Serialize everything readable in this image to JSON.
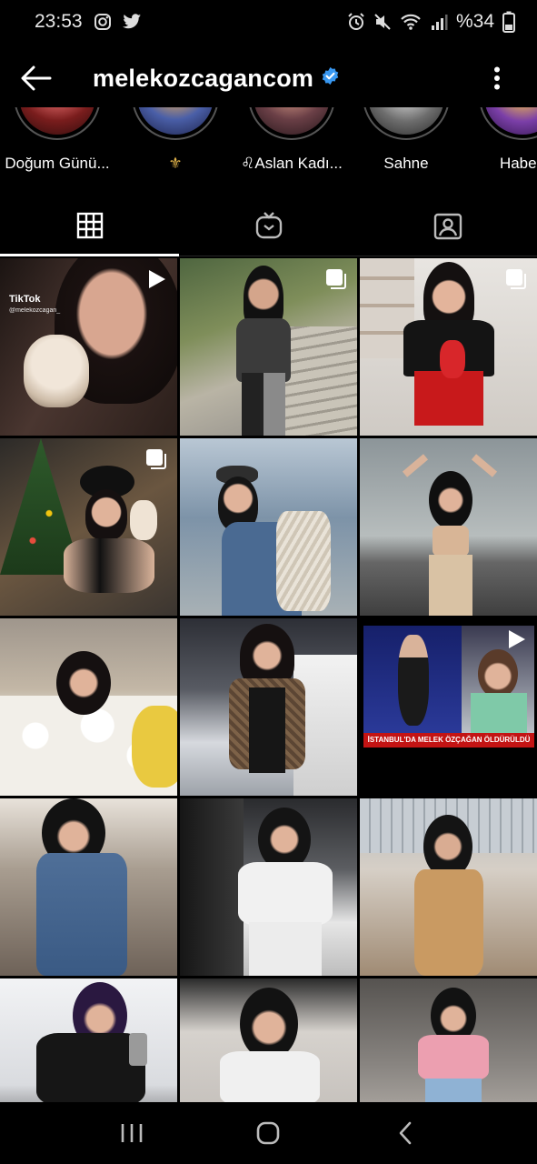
{
  "status_bar": {
    "time": "23:53",
    "battery": "%34"
  },
  "header": {
    "username": "melekozcagancom",
    "verified": true
  },
  "highlights": [
    {
      "label": "Doğum Günü...",
      "color": "#b33a3a"
    },
    {
      "label": "⚜",
      "color": "#4a5fa8"
    },
    {
      "label": "♌Aslan Kadı...",
      "color": "#6a3f46"
    },
    {
      "label": "Sahne",
      "color": "#6d6d6d"
    },
    {
      "label": "Haberl",
      "color": "#7b3fa8"
    }
  ],
  "tabs": [
    {
      "name": "grid",
      "icon": "grid-icon",
      "active": true
    },
    {
      "name": "igtv",
      "icon": "igtv-icon",
      "active": false
    },
    {
      "name": "tagged",
      "icon": "tagged-icon",
      "active": false
    }
  ],
  "posts": [
    {
      "type": "video",
      "tiktok_label": "TikTok",
      "tiktok_handle": "@melekozcagan_",
      "bg": "#3a2a26"
    },
    {
      "type": "carousel",
      "bg": "#6f7a55"
    },
    {
      "type": "carousel",
      "bg": "#d8d4d0"
    },
    {
      "type": "carousel",
      "bg": "#5a4636"
    },
    {
      "type": "photo",
      "bg": "#8fa3b8"
    },
    {
      "type": "photo",
      "bg": "#9aa4a8"
    },
    {
      "type": "photo",
      "bg": "#c8b9a6"
    },
    {
      "type": "photo",
      "bg": "#3b3d42"
    },
    {
      "type": "video",
      "news_caption": "İSTANBUL'DA MELEK ÖZÇAĞAN ÖLDÜRÜLDÜ",
      "bg": "#1f2a7a"
    },
    {
      "type": "photo",
      "bg": "#9a8d80"
    },
    {
      "type": "photo",
      "bg": "#6c6a66"
    },
    {
      "type": "photo",
      "bg": "#c9b9a4"
    },
    {
      "type": "photo",
      "bg": "#e0e2e6"
    },
    {
      "type": "photo",
      "bg": "#b7b5b2"
    },
    {
      "type": "photo",
      "bg": "#8a8682"
    }
  ],
  "colors": {
    "background": "#000000",
    "verified_badge": "#3897f0",
    "divider": "#262626"
  }
}
